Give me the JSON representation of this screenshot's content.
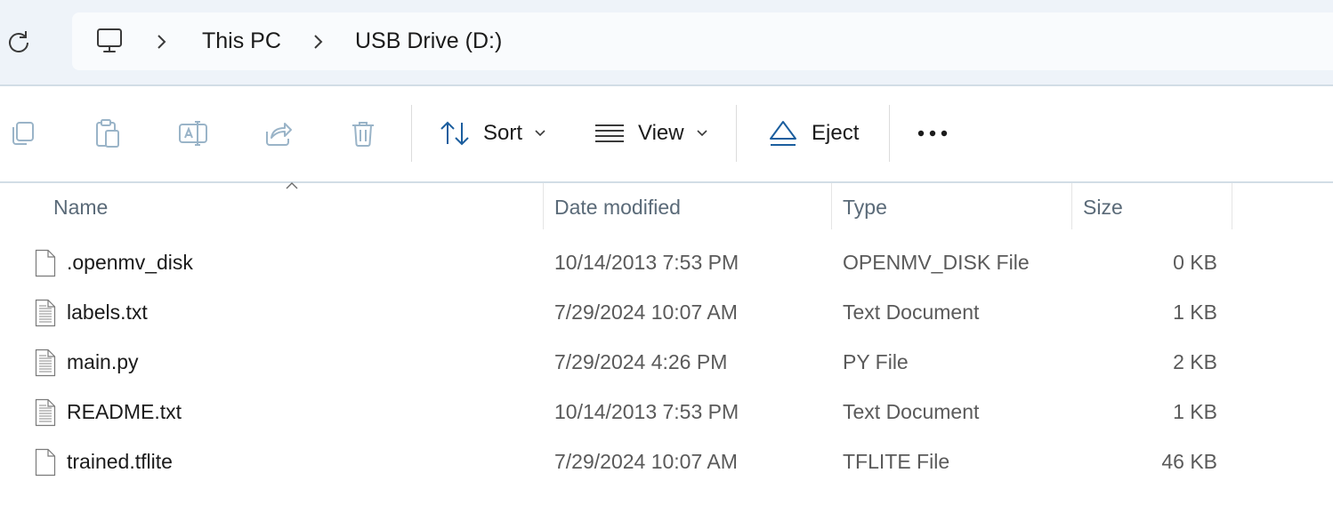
{
  "address_bar": {
    "breadcrumbs": [
      {
        "label": "This PC"
      },
      {
        "label": "USB Drive (D:)"
      }
    ],
    "root_icon": "computer-icon"
  },
  "command_bar": {
    "disabled_actions": [
      "copy",
      "paste",
      "rename",
      "share",
      "delete"
    ],
    "sort_label": "Sort",
    "view_label": "View",
    "eject_label": "Eject",
    "more_icon": "ellipsis-icon"
  },
  "columns": {
    "name": "Name",
    "date": "Date modified",
    "type": "Type",
    "size": "Size",
    "sorted_by": "name"
  },
  "files": [
    {
      "name": ".openmv_disk",
      "date": "10/14/2013 7:53 PM",
      "type": "OPENMV_DISK File",
      "size": "0 KB",
      "icon": "blank-file-icon"
    },
    {
      "name": "labels.txt",
      "date": "7/29/2024 10:07 AM",
      "type": "Text Document",
      "size": "1 KB",
      "icon": "text-file-icon"
    },
    {
      "name": "main.py",
      "date": "7/29/2024 4:26 PM",
      "type": "PY File",
      "size": "2 KB",
      "icon": "text-file-icon"
    },
    {
      "name": "README.txt",
      "date": "10/14/2013 7:53 PM",
      "type": "Text Document",
      "size": "1 KB",
      "icon": "text-file-icon"
    },
    {
      "name": "trained.tflite",
      "date": "7/29/2024 10:07 AM",
      "type": "TFLITE File",
      "size": "46 KB",
      "icon": "blank-file-icon"
    }
  ],
  "colors": {
    "accent": "#005fb8",
    "disabled_icon": "#9ab4c8",
    "header_text": "#5a6a78"
  }
}
